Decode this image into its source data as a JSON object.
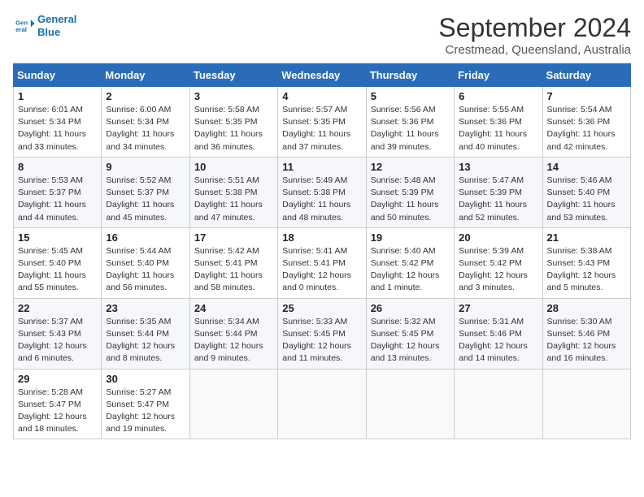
{
  "header": {
    "logo_line1": "General",
    "logo_line2": "Blue",
    "month": "September 2024",
    "location": "Crestmead, Queensland, Australia"
  },
  "weekdays": [
    "Sunday",
    "Monday",
    "Tuesday",
    "Wednesday",
    "Thursday",
    "Friday",
    "Saturday"
  ],
  "weeks": [
    [
      {
        "day": "1",
        "info": "Sunrise: 6:01 AM\nSunset: 5:34 PM\nDaylight: 11 hours\nand 33 minutes."
      },
      {
        "day": "2",
        "info": "Sunrise: 6:00 AM\nSunset: 5:34 PM\nDaylight: 11 hours\nand 34 minutes."
      },
      {
        "day": "3",
        "info": "Sunrise: 5:58 AM\nSunset: 5:35 PM\nDaylight: 11 hours\nand 36 minutes."
      },
      {
        "day": "4",
        "info": "Sunrise: 5:57 AM\nSunset: 5:35 PM\nDaylight: 11 hours\nand 37 minutes."
      },
      {
        "day": "5",
        "info": "Sunrise: 5:56 AM\nSunset: 5:36 PM\nDaylight: 11 hours\nand 39 minutes."
      },
      {
        "day": "6",
        "info": "Sunrise: 5:55 AM\nSunset: 5:36 PM\nDaylight: 11 hours\nand 40 minutes."
      },
      {
        "day": "7",
        "info": "Sunrise: 5:54 AM\nSunset: 5:36 PM\nDaylight: 11 hours\nand 42 minutes."
      }
    ],
    [
      {
        "day": "8",
        "info": "Sunrise: 5:53 AM\nSunset: 5:37 PM\nDaylight: 11 hours\nand 44 minutes."
      },
      {
        "day": "9",
        "info": "Sunrise: 5:52 AM\nSunset: 5:37 PM\nDaylight: 11 hours\nand 45 minutes."
      },
      {
        "day": "10",
        "info": "Sunrise: 5:51 AM\nSunset: 5:38 PM\nDaylight: 11 hours\nand 47 minutes."
      },
      {
        "day": "11",
        "info": "Sunrise: 5:49 AM\nSunset: 5:38 PM\nDaylight: 11 hours\nand 48 minutes."
      },
      {
        "day": "12",
        "info": "Sunrise: 5:48 AM\nSunset: 5:39 PM\nDaylight: 11 hours\nand 50 minutes."
      },
      {
        "day": "13",
        "info": "Sunrise: 5:47 AM\nSunset: 5:39 PM\nDaylight: 11 hours\nand 52 minutes."
      },
      {
        "day": "14",
        "info": "Sunrise: 5:46 AM\nSunset: 5:40 PM\nDaylight: 11 hours\nand 53 minutes."
      }
    ],
    [
      {
        "day": "15",
        "info": "Sunrise: 5:45 AM\nSunset: 5:40 PM\nDaylight: 11 hours\nand 55 minutes."
      },
      {
        "day": "16",
        "info": "Sunrise: 5:44 AM\nSunset: 5:40 PM\nDaylight: 11 hours\nand 56 minutes."
      },
      {
        "day": "17",
        "info": "Sunrise: 5:42 AM\nSunset: 5:41 PM\nDaylight: 11 hours\nand 58 minutes."
      },
      {
        "day": "18",
        "info": "Sunrise: 5:41 AM\nSunset: 5:41 PM\nDaylight: 12 hours\nand 0 minutes."
      },
      {
        "day": "19",
        "info": "Sunrise: 5:40 AM\nSunset: 5:42 PM\nDaylight: 12 hours\nand 1 minute."
      },
      {
        "day": "20",
        "info": "Sunrise: 5:39 AM\nSunset: 5:42 PM\nDaylight: 12 hours\nand 3 minutes."
      },
      {
        "day": "21",
        "info": "Sunrise: 5:38 AM\nSunset: 5:43 PM\nDaylight: 12 hours\nand 5 minutes."
      }
    ],
    [
      {
        "day": "22",
        "info": "Sunrise: 5:37 AM\nSunset: 5:43 PM\nDaylight: 12 hours\nand 6 minutes."
      },
      {
        "day": "23",
        "info": "Sunrise: 5:35 AM\nSunset: 5:44 PM\nDaylight: 12 hours\nand 8 minutes."
      },
      {
        "day": "24",
        "info": "Sunrise: 5:34 AM\nSunset: 5:44 PM\nDaylight: 12 hours\nand 9 minutes."
      },
      {
        "day": "25",
        "info": "Sunrise: 5:33 AM\nSunset: 5:45 PM\nDaylight: 12 hours\nand 11 minutes."
      },
      {
        "day": "26",
        "info": "Sunrise: 5:32 AM\nSunset: 5:45 PM\nDaylight: 12 hours\nand 13 minutes."
      },
      {
        "day": "27",
        "info": "Sunrise: 5:31 AM\nSunset: 5:46 PM\nDaylight: 12 hours\nand 14 minutes."
      },
      {
        "day": "28",
        "info": "Sunrise: 5:30 AM\nSunset: 5:46 PM\nDaylight: 12 hours\nand 16 minutes."
      }
    ],
    [
      {
        "day": "29",
        "info": "Sunrise: 5:28 AM\nSunset: 5:47 PM\nDaylight: 12 hours\nand 18 minutes."
      },
      {
        "day": "30",
        "info": "Sunrise: 5:27 AM\nSunset: 5:47 PM\nDaylight: 12 hours\nand 19 minutes."
      },
      {
        "day": "",
        "info": ""
      },
      {
        "day": "",
        "info": ""
      },
      {
        "day": "",
        "info": ""
      },
      {
        "day": "",
        "info": ""
      },
      {
        "day": "",
        "info": ""
      }
    ]
  ]
}
